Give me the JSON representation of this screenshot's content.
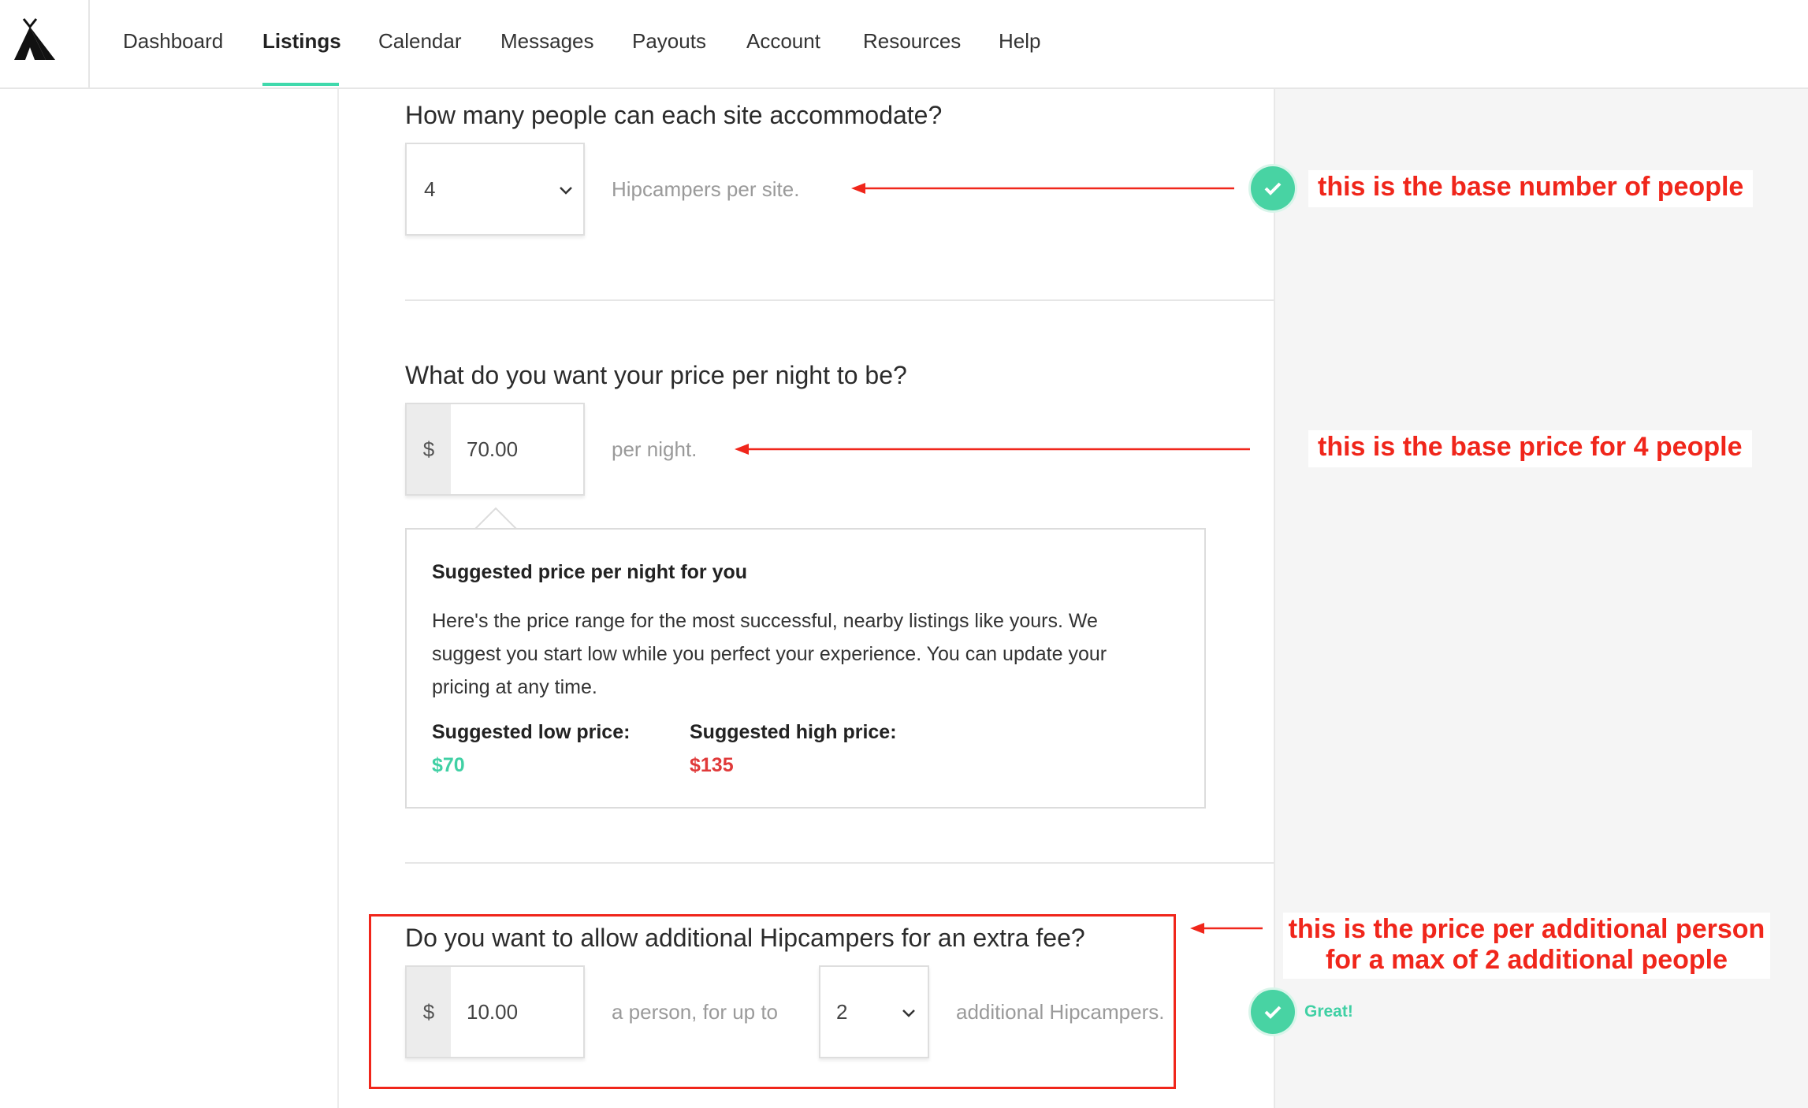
{
  "nav": {
    "items": [
      "Dashboard",
      "Listings",
      "Calendar",
      "Messages",
      "Payouts",
      "Account",
      "Resources",
      "Help"
    ],
    "active": "Listings"
  },
  "section_capacity": {
    "question": "How many people can each site accommodate?",
    "value": "4",
    "suffix": "Hipcampers per site."
  },
  "section_price": {
    "question": "What do you want your price per night to be?",
    "currency": "$",
    "value": "70.00",
    "suffix": "per night."
  },
  "suggestion": {
    "title": "Suggested price per night for you",
    "body": "Here's the price range for the most successful, nearby listings like yours. We suggest you start low while you perfect your experience. You can update your pricing at any time.",
    "low_label": "Suggested low price:",
    "low_value": "$70",
    "high_label": "Suggested high price:",
    "high_value": "$135"
  },
  "section_extra": {
    "question": "Do you want to allow additional Hipcampers for an extra fee?",
    "currency": "$",
    "value": "10.00",
    "middle_text": "a person, for up to",
    "count_value": "2",
    "suffix": "additional Hipcampers.",
    "status": "Great!"
  },
  "annotations": {
    "people": "this is the base number of people",
    "price": "this is the base price for 4 people",
    "extra_line1": "this is the price per additional person",
    "extra_line2": "for a max of 2 additional people"
  },
  "colors": {
    "accent": "#40d9ac",
    "annotation_red": "#f0261b",
    "high_price": "#e03a3a"
  }
}
